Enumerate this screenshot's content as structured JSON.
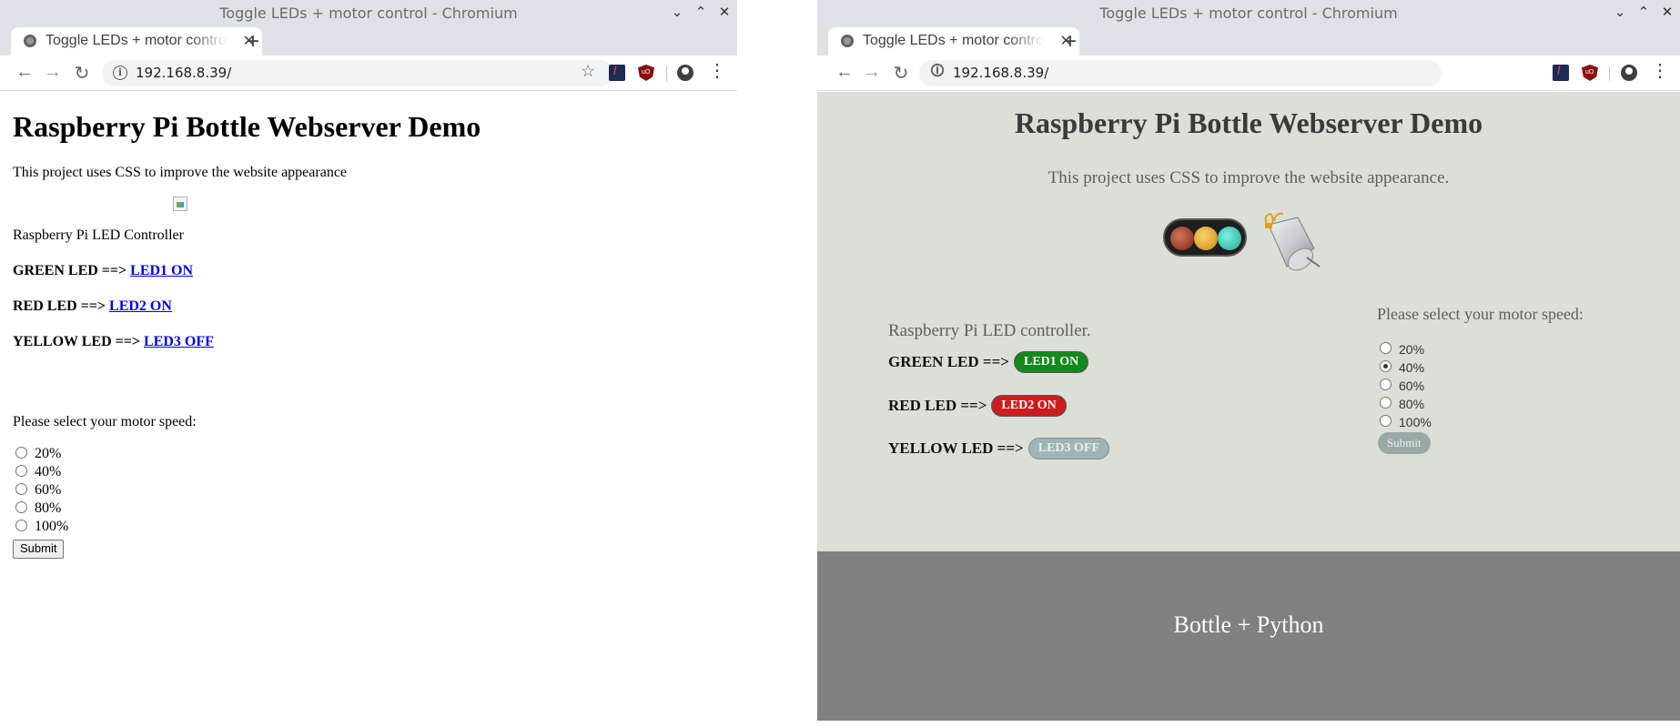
{
  "left_window": {
    "window_title": "Toggle LEDs + motor control - Chromium",
    "tab_title": "Toggle LEDs + motor control - Chromium",
    "url": "192.168.8.39/",
    "page": {
      "heading": "Raspberry Pi Bottle Webserver Demo",
      "intro": "This project uses CSS to improve the website appearance",
      "controller_title": "Raspberry Pi LED Controller",
      "leds": [
        {
          "label": "GREEN LED ==> ",
          "link": "LED1 ON"
        },
        {
          "label": "RED LED ==> ",
          "link": "LED2 ON"
        },
        {
          "label": "YELLOW LED ==> ",
          "link": "LED3 OFF"
        }
      ],
      "speed_prompt": "Please select your motor speed:",
      "speeds": [
        "20%",
        "40%",
        "60%",
        "80%",
        "100%"
      ],
      "selected_speed": null,
      "submit": "Submit"
    }
  },
  "right_window": {
    "window_title": "Toggle LEDs + motor control - Chromium",
    "tab_title": "Toggle LEDs + motor control - Chromium",
    "url": "192.168.8.39/",
    "page": {
      "heading": "Raspberry Pi Bottle Webserver Demo",
      "intro": "This project uses CSS to improve the website appearance.",
      "controller_title": "Raspberry Pi LED controller.",
      "leds": [
        {
          "label": "GREEN LED ==>",
          "button": "LED1 ON",
          "color": "#128a1a"
        },
        {
          "label": "RED LED ==>",
          "button": "LED2 ON",
          "color": "#cc1d1d"
        },
        {
          "label": "YELLOW LED ==>",
          "button": "LED3 OFF",
          "color": "#a0b4b6"
        }
      ],
      "speed_prompt": "Please select your motor speed:",
      "speeds": [
        "20%",
        "40%",
        "60%",
        "80%",
        "100%"
      ],
      "selected_speed": "40%",
      "submit": "Submit",
      "footer": "Bottle + Python",
      "colors": {
        "content_bg": "#dcdfd6",
        "footer_bg": "#808080"
      }
    }
  },
  "icons": {
    "favicon": "globe-icon",
    "back": "arrow-left-icon",
    "forward": "arrow-right-icon",
    "reload": "reload-icon",
    "site_info": "info-icon",
    "bookmark": "star-icon",
    "extension_1": "extension-icon",
    "extension_2": "ublock-icon",
    "profile": "profile-icon",
    "menu": "kebab-menu-icon",
    "traffic_light": "traffic-light-image",
    "motor": "dc-motor-image"
  }
}
